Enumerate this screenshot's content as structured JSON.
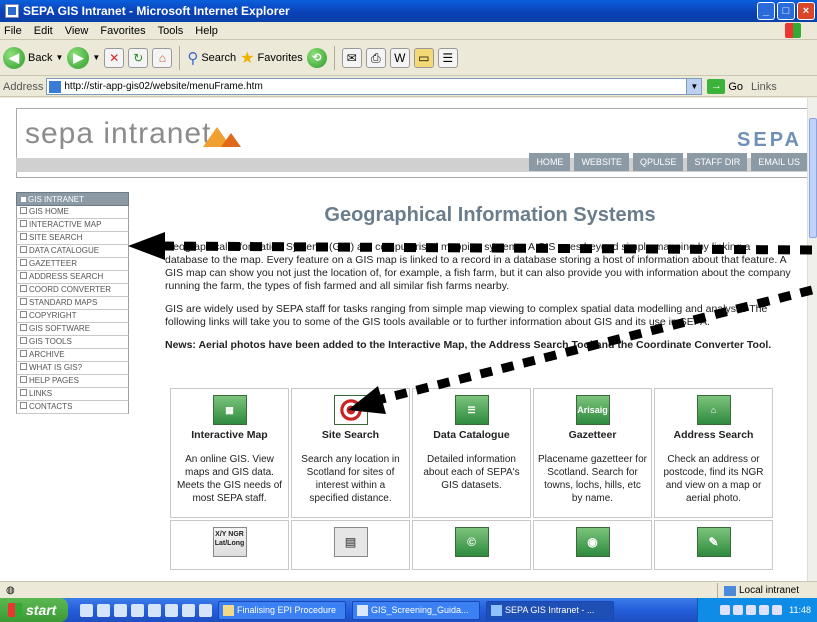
{
  "window": {
    "title": "SEPA GIS Intranet - Microsoft Internet Explorer"
  },
  "menu": [
    "File",
    "Edit",
    "View",
    "Favorites",
    "Tools",
    "Help"
  ],
  "toolbar": {
    "back_label": "Back",
    "search_label": "Search",
    "favorites_label": "Favorites"
  },
  "address": {
    "label": "Address",
    "url": "http://stir-app-gis02/website/menuFrame.htm",
    "go_label": "Go",
    "links_label": "Links"
  },
  "header": {
    "logo_text": "sepa intranet",
    "brand": "SEPA",
    "nav": [
      "HOME",
      "WEBSITE",
      "QPULSE",
      "STAFF DIR",
      "EMAIL US"
    ]
  },
  "leftnav": {
    "heading": "GIS INTRANET",
    "items": [
      "GIS HOME",
      "INTERACTIVE MAP",
      "SITE SEARCH",
      "DATA CATALOGUE",
      "GAZETTEER",
      "ADDRESS SEARCH",
      "COORD CONVERTER",
      "STANDARD MAPS",
      "COPYRIGHT",
      "GIS SOFTWARE",
      "GIS TOOLS",
      "ARCHIVE",
      "WHAT IS GIS?",
      "HELP PAGES",
      "LINKS",
      "CONTACTS"
    ]
  },
  "main": {
    "title": "Geographical Information Systems",
    "para1": "Geographical Information Systems (GIS) are computerised mapping systems. A GIS goes beyond simple mapping by linking a database to the map. Every feature on a GIS map is linked to a record in a database storing a host of information about that feature. A GIS map can show you not just the location of, for example, a fish farm, but it can also provide you with information about the company running the farm, the types of fish farmed and all similar fish farms nearby.",
    "para2": "GIS are widely used by SEPA staff for tasks ranging from simple map viewing to complex spatial data modelling and analysis. The following links will take you to some of the GIS tools available or to further information about GIS and its use in SEPA.",
    "news": "News:  Aerial photos have been added to the Interactive Map, the Address Search Tool and the Coordinate Converter Tool."
  },
  "tools": [
    {
      "title": "Interactive Map",
      "desc": "An online GIS. View maps and GIS data. Meets the GIS needs of most SEPA staff.",
      "icon": "map-icon"
    },
    {
      "title": "Site Search",
      "desc": "Search any location in Scotland for sites of interest within a specified distance.",
      "icon": "target-icon"
    },
    {
      "title": "Data Catalogue",
      "desc": "Detailed information about each of SEPA's GIS datasets.",
      "icon": "catalogue-icon"
    },
    {
      "title": "Gazetteer",
      "desc": "Placename gazetteer for Scotland. Search for towns, lochs, hills, etc by name.",
      "icon_text": "Arisaig"
    },
    {
      "title": "Address Search",
      "desc": "Check an address or postcode, find its NGR and view on a map or aerial photo.",
      "icon": "house-icon"
    }
  ],
  "tools_row2": [
    {
      "icon": "coord-icon",
      "icon_text": "X/Y NGR Lat/Long"
    },
    {
      "icon": "standard-maps-icon"
    },
    {
      "icon": "copyright-icon",
      "icon_text": "©"
    },
    {
      "icon": "software-icon"
    },
    {
      "icon": "tools-icon"
    }
  ],
  "status": {
    "zone": "Local intranet"
  },
  "taskbar": {
    "start": "start",
    "tasks": [
      "Finalising EPI Procedure",
      "GIS_Screening_Guida...",
      "SEPA GIS Intranet - ..."
    ],
    "clock": "11:48"
  }
}
